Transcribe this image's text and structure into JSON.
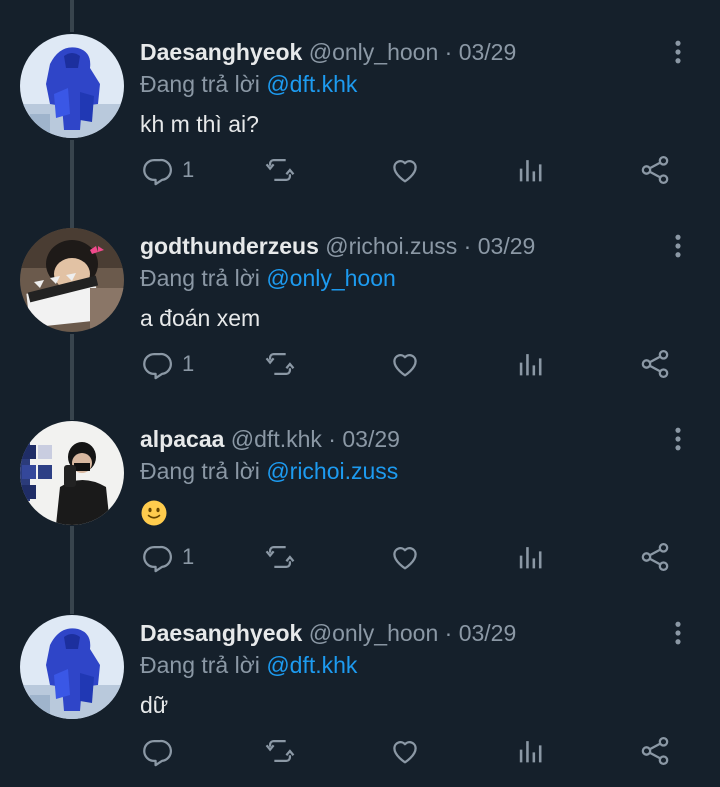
{
  "thread": {
    "reply_prefix": "Đang trả lời",
    "tweets": [
      {
        "name": "Daesanghyeok",
        "handle": "@only_hoon",
        "dot": "·",
        "date": "03/29",
        "reply_to": "@dft.khk",
        "text": "kh m thì ai?",
        "reply_count": "1",
        "avatar": "blue-figure-avatar"
      },
      {
        "name": "godthunderzeus",
        "handle": "@richoi.zuss",
        "dot": "·",
        "date": "03/29",
        "reply_to": "@only_hoon",
        "text": "a đoán xem",
        "reply_count": "1",
        "avatar": "clapperboard-avatar"
      },
      {
        "name": "alpacaa",
        "handle": "@dft.khk",
        "dot": "·",
        "date": "03/29",
        "reply_to": "@richoi.zuss",
        "text": "🙂",
        "reply_count": "1",
        "avatar": "mirror-selfie-avatar"
      },
      {
        "name": "Daesanghyeok",
        "handle": "@only_hoon",
        "dot": "·",
        "date": "03/29",
        "reply_to": "@dft.khk",
        "text": "dữ",
        "reply_count": "",
        "avatar": "blue-figure-avatar"
      }
    ]
  },
  "colors": {
    "background": "#15202b",
    "text": "#e7e9ea",
    "muted": "#8b98a5",
    "mention": "#1d9bf0",
    "thread_line": "#38444d"
  },
  "icons": [
    "more-vertical-icon",
    "reply-icon",
    "retweet-icon",
    "like-icon",
    "views-icon",
    "share-icon"
  ]
}
